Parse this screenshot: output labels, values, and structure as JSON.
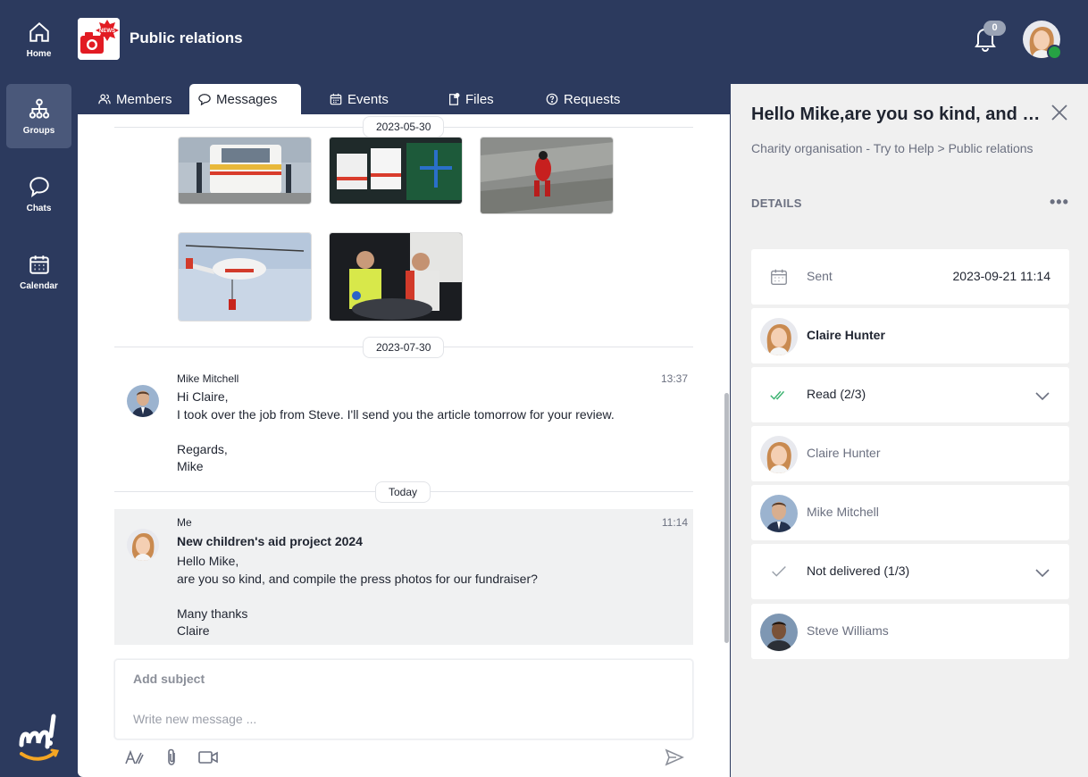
{
  "nav": {
    "items": [
      {
        "label": "Home",
        "icon": "home-icon"
      },
      {
        "label": "Groups",
        "icon": "groups-icon"
      },
      {
        "label": "Chats",
        "icon": "chat-icon"
      },
      {
        "label": "Calendar",
        "icon": "calendar-icon"
      }
    ]
  },
  "header": {
    "group_title": "Public relations",
    "group_badge_text": "NEWS",
    "notifications_count": "0"
  },
  "tabs": [
    {
      "label": "Members",
      "icon": "members-icon"
    },
    {
      "label": "Messages",
      "icon": "message-icon"
    },
    {
      "label": "Events",
      "icon": "events-icon"
    },
    {
      "label": "Files",
      "icon": "files-icon"
    },
    {
      "label": "Requests",
      "icon": "requests-icon"
    }
  ],
  "feed": {
    "date_1": "2023-05-30",
    "date_2": "2023-07-30",
    "date_3": "Today",
    "messages": [
      {
        "author": "Mike Mitchell",
        "time": "13:37",
        "body": "Hi Claire,\nI took over the job from Steve. I'll send you the article tomorrow for your review.\n\nRegards,\nMike"
      },
      {
        "author": "Me",
        "time": "11:14",
        "subject": "New children's aid project 2024",
        "body": "Hello Mike,\nare you so kind, and compile the press photos for our fundraiser?\n\nMany thanks\nClaire"
      }
    ]
  },
  "composer": {
    "subject_placeholder": "Add subject",
    "body_placeholder": "Write new message ..."
  },
  "panel": {
    "title": "Hello Mike,are you so kind, and compile the press photos for our fundraiser?",
    "breadcrumb": "Charity organisation - Try to Help > Public relations",
    "section_label": "DETAILS",
    "sent_label": "Sent",
    "sent_value": "2023-09-21 11:14",
    "sender_name": "Claire Hunter",
    "read_label": "Read (2/3)",
    "read_users": [
      "Claire Hunter",
      "Mike Mitchell"
    ],
    "not_delivered_label": "Not delivered (1/3)",
    "not_delivered_users": [
      "Steve Williams"
    ]
  },
  "colors": {
    "sidebar_bg": "#2c3a5e",
    "read_check": "#3cb371",
    "status_online": "#26a244"
  }
}
